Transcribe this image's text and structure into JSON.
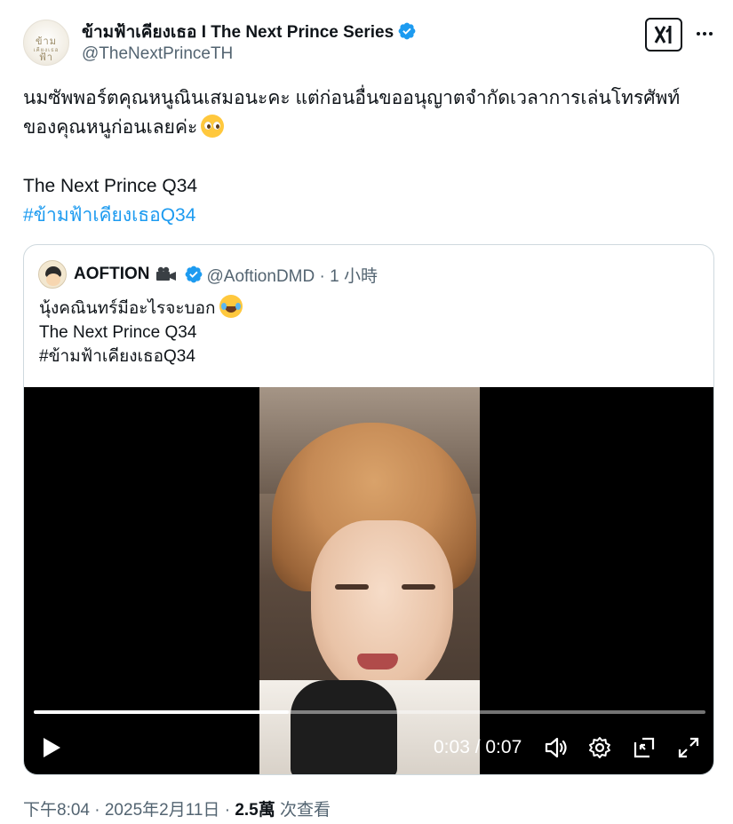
{
  "author": {
    "name": "ข้ามฟ้าเคียงเธอ I The Next Prince Series",
    "handle": "@TheNextPrinceTH",
    "avatar_text_line1": "ข้ามฟ้า",
    "avatar_text_line2": "เคียงเธอ"
  },
  "tweet": {
    "line1": "นมซัพพอร์ตคุณหนูณินเสมอนะคะ แต่ก่อนอื่นขออนุญาตจำกัดเวลาการเล่นโทรศัพท์",
    "line2": "ของคุณหนูก่อนเลยค่ะ",
    "line3": "The Next Prince Q34",
    "hashtag": "#ข้ามฟ้าเคียงเธอQ34"
  },
  "quote": {
    "name": "AOFTION",
    "handle_time": "@AoftionDMD · 1 小時",
    "line1": "นุ้งคณินทร์มีอะไรจะบอก",
    "line2": "The Next Prince Q34",
    "line3": "#ข้ามฟ้าเคียงเธอQ34"
  },
  "video": {
    "time": "0:03 / 0:07",
    "progress": 0.38
  },
  "meta": {
    "time": "下午8:04 · 2025年2月11日 · ",
    "views": "2.5萬",
    "views_label": " 次查看"
  },
  "icons": {
    "verified": "verified-badge-icon",
    "grok": "grok-icon",
    "more": "more-icon",
    "play": "play-icon",
    "volume": "volume-icon",
    "settings": "settings-icon",
    "pip": "pip-icon",
    "fullscreen": "fullscreen-icon"
  },
  "colors": {
    "link": "#1d9bf0",
    "text": "#0f1419",
    "secondary": "#536471",
    "border": "#cfd9de"
  }
}
